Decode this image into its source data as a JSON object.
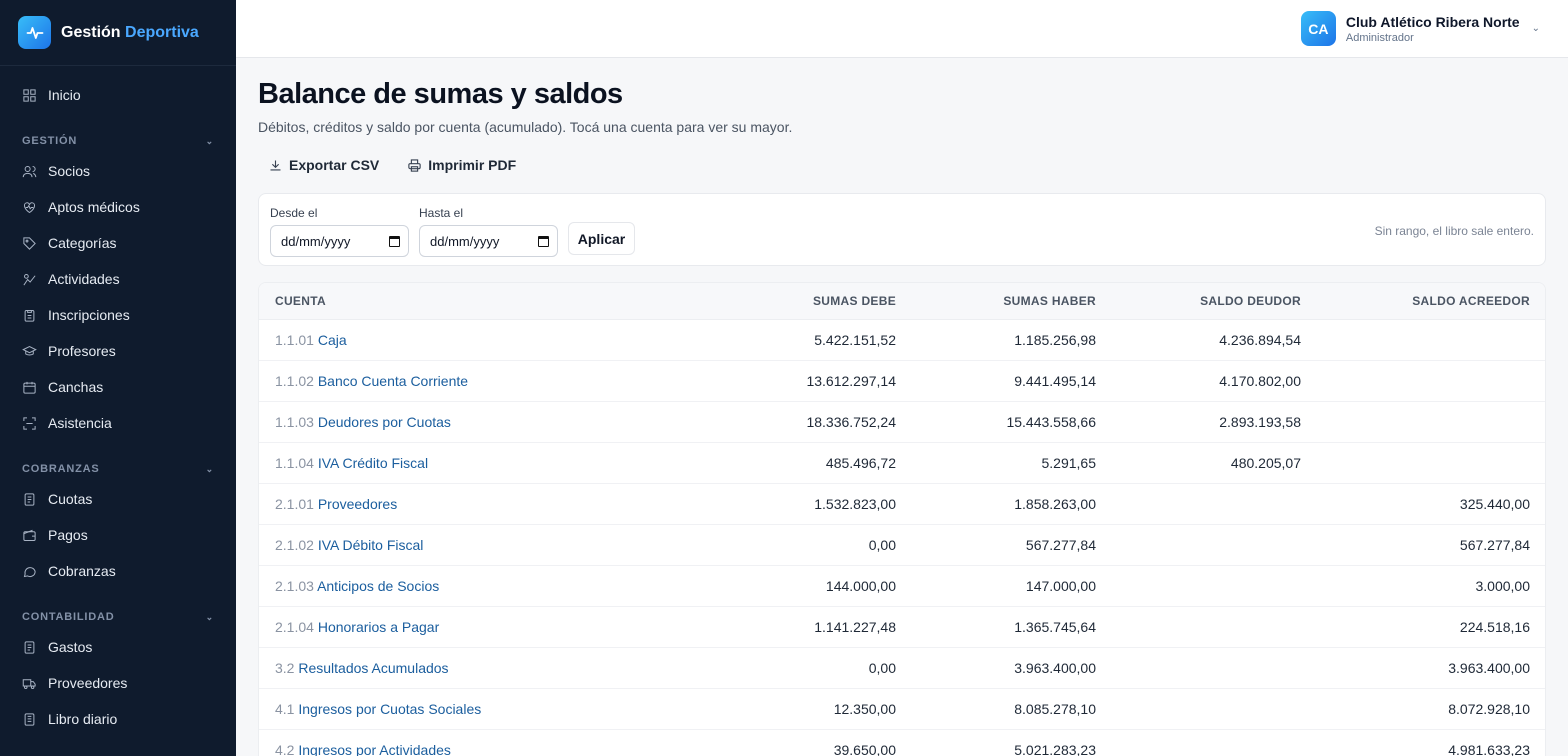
{
  "brand": {
    "name_part1": "Gestión",
    "name_part2": "Deportiva"
  },
  "sidebar": {
    "home": {
      "label": "Inicio",
      "icon": "grid-icon"
    },
    "sections": [
      {
        "title": "GESTIÓN",
        "items": [
          {
            "label": "Socios",
            "icon": "users-icon"
          },
          {
            "label": "Aptos médicos",
            "icon": "heart-pulse-icon"
          },
          {
            "label": "Categorías",
            "icon": "tag-icon"
          },
          {
            "label": "Actividades",
            "icon": "activity-icon"
          },
          {
            "label": "Inscripciones",
            "icon": "clipboard-icon"
          },
          {
            "label": "Profesores",
            "icon": "graduation-cap-icon"
          },
          {
            "label": "Canchas",
            "icon": "calendar-icon"
          },
          {
            "label": "Asistencia",
            "icon": "scan-icon"
          }
        ]
      },
      {
        "title": "COBRANZAS",
        "items": [
          {
            "label": "Cuotas",
            "icon": "receipt-icon"
          },
          {
            "label": "Pagos",
            "icon": "wallet-icon"
          },
          {
            "label": "Cobranzas",
            "icon": "message-icon"
          }
        ]
      },
      {
        "title": "CONTABILIDAD",
        "items": [
          {
            "label": "Gastos",
            "icon": "receipt-icon"
          },
          {
            "label": "Proveedores",
            "icon": "truck-icon"
          },
          {
            "label": "Libro diario",
            "icon": "book-icon"
          }
        ]
      }
    ]
  },
  "topbar": {
    "avatar_initials": "CA",
    "user_name": "Club Atlético Ribera Norte",
    "user_role": "Administrador"
  },
  "page": {
    "title": "Balance de sumas y saldos",
    "subtitle": "Débitos, créditos y saldo por cuenta (acumulado). Tocá una cuenta para ver su mayor.",
    "export_csv": "Exportar CSV",
    "print_pdf": "Imprimir PDF"
  },
  "filter": {
    "from_label": "Desde el",
    "from_value": "dd/mm/yyyy",
    "to_label": "Hasta el",
    "to_value": "dd/mm/yyyy",
    "apply_label": "Aplicar",
    "note": "Sin rango, el libro sale entero."
  },
  "table": {
    "headers": [
      "CUENTA",
      "SUMAS DEBE",
      "SUMAS HABER",
      "SALDO DEUDOR",
      "SALDO ACREEDOR"
    ],
    "rows": [
      {
        "code": "1.1.01",
        "name": "Caja",
        "debe": "5.422.151,52",
        "haber": "1.185.256,98",
        "deudor": "4.236.894,54",
        "acreedor": ""
      },
      {
        "code": "1.1.02",
        "name": "Banco Cuenta Corriente",
        "debe": "13.612.297,14",
        "haber": "9.441.495,14",
        "deudor": "4.170.802,00",
        "acreedor": ""
      },
      {
        "code": "1.1.03",
        "name": "Deudores por Cuotas",
        "debe": "18.336.752,24",
        "haber": "15.443.558,66",
        "deudor": "2.893.193,58",
        "acreedor": ""
      },
      {
        "code": "1.1.04",
        "name": "IVA Crédito Fiscal",
        "debe": "485.496,72",
        "haber": "5.291,65",
        "deudor": "480.205,07",
        "acreedor": ""
      },
      {
        "code": "2.1.01",
        "name": "Proveedores",
        "debe": "1.532.823,00",
        "haber": "1.858.263,00",
        "deudor": "",
        "acreedor": "325.440,00"
      },
      {
        "code": "2.1.02",
        "name": "IVA Débito Fiscal",
        "debe": "0,00",
        "haber": "567.277,84",
        "deudor": "",
        "acreedor": "567.277,84"
      },
      {
        "code": "2.1.03",
        "name": "Anticipos de Socios",
        "debe": "144.000,00",
        "haber": "147.000,00",
        "deudor": "",
        "acreedor": "3.000,00"
      },
      {
        "code": "2.1.04",
        "name": "Honorarios a Pagar",
        "debe": "1.141.227,48",
        "haber": "1.365.745,64",
        "deudor": "",
        "acreedor": "224.518,16"
      },
      {
        "code": "3.2",
        "name": "Resultados Acumulados",
        "debe": "0,00",
        "haber": "3.963.400,00",
        "deudor": "",
        "acreedor": "3.963.400,00"
      },
      {
        "code": "4.1",
        "name": "Ingresos por Cuotas Sociales",
        "debe": "12.350,00",
        "haber": "8.085.278,10",
        "deudor": "",
        "acreedor": "8.072.928,10"
      },
      {
        "code": "4.2",
        "name": "Ingresos por Actividades",
        "debe": "39.650,00",
        "haber": "5.021.283,23",
        "deudor": "",
        "acreedor": "4.981.633,23"
      }
    ]
  }
}
